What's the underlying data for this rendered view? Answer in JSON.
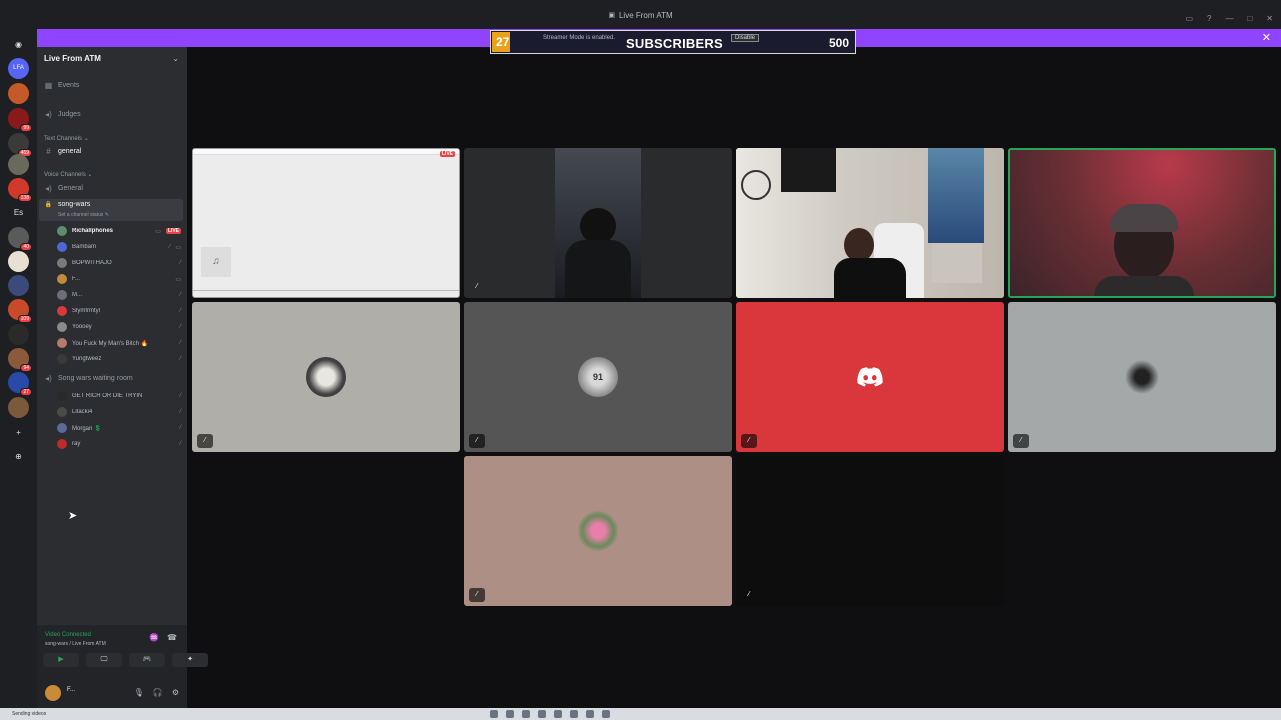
{
  "window": {
    "title": "Live From ATM",
    "controls": [
      "▭",
      "?",
      "—",
      "□",
      "✕"
    ]
  },
  "banner": {
    "close": "✕"
  },
  "streamer_widget": {
    "number": "27",
    "message": "Streamer Mode is enabled.",
    "disable_label": "Disable",
    "title": "SUBSCRIBERS",
    "goal": "500"
  },
  "guilds": {
    "home": "◉",
    "lfa": "LFA",
    "es": "Es",
    "add": "+",
    "discover": "⊕",
    "badges": [
      "",
      "",
      "99",
      "469",
      "",
      "138",
      "",
      "40",
      "",
      "",
      "109",
      "",
      "94",
      "",
      "27",
      ""
    ]
  },
  "sidebar": {
    "server_name": "Live From ATM",
    "server_chevron": "⌄",
    "channels": [
      {
        "icon": "▦",
        "label": "Events"
      },
      {
        "icon": "◂)",
        "label": "Judges"
      }
    ],
    "text_category": "Text Channels ⌄",
    "text_channels": [
      {
        "icon": "#",
        "label": "general"
      }
    ],
    "voice_category": "Voice Channels ⌄",
    "voice_general": {
      "icon": "◂)",
      "label": "General"
    },
    "song_wars": {
      "icon": "🔒",
      "label": "song-wars",
      "status": "Set a channel status ✎"
    },
    "song_wars_users": [
      {
        "name": "Richallphones",
        "live": "LIVE",
        "color": "#5a8f6a"
      },
      {
        "name": "Bambam",
        "live": "",
        "color": "#4b6ad1"
      },
      {
        "name": "BOPWITHAJO",
        "live": "",
        "color": "#7a7a7a"
      },
      {
        "name": "F...",
        "live": "",
        "color": "#c08a3a"
      },
      {
        "name": "M...",
        "live": "",
        "color": "#6d6f78"
      },
      {
        "name": "Slymfrmtyl",
        "live": "",
        "color": "#d63a3a"
      },
      {
        "name": "Yoooey",
        "live": "",
        "color": "#8a8a8a"
      },
      {
        "name": "You Fuck My Man's Bitch 🔥",
        "live": "",
        "color": "#b87a6a"
      },
      {
        "name": "Yungtweez",
        "live": "",
        "color": "#3a3a3a"
      }
    ],
    "waiting_room": {
      "icon": "◂)",
      "label": "Song wars waiting room"
    },
    "waiting_users": [
      {
        "name": "GET RICH OR DIE TRYIN",
        "color": "#2a2a2a"
      },
      {
        "name": "Litacki4",
        "color": "#4a4a4a"
      },
      {
        "name": "Morgan 💲",
        "color": "#5a6a9a"
      },
      {
        "name": "ray",
        "color": "#c02a2a"
      }
    ],
    "panel": {
      "status": "Video Connected",
      "location": "song-wars / Live From ATM",
      "buttons": [
        "▶",
        "🖵",
        "🎮",
        "✦"
      ],
      "username": "F...",
      "controls": [
        "🎙",
        "🎧",
        "⚙"
      ]
    }
  },
  "tiles": [
    {
      "id": "screen-share",
      "live": "LIVE"
    },
    {
      "id": "dark-cam"
    },
    {
      "id": "room-cam"
    },
    {
      "id": "red-cam"
    },
    {
      "id": "avatar-gray",
      "color": "#b0aea8"
    },
    {
      "id": "avatar-dark",
      "color": "#555555"
    },
    {
      "id": "discord-red",
      "color": "#da373c"
    },
    {
      "id": "avatar-silver",
      "color": "#a5a8a9"
    },
    {
      "id": "avatar-pink",
      "color": "#ad8f86"
    },
    {
      "id": "empty-black",
      "color": "#0d0d0d"
    }
  ],
  "taskbar": {
    "recording": "Sending videos"
  }
}
